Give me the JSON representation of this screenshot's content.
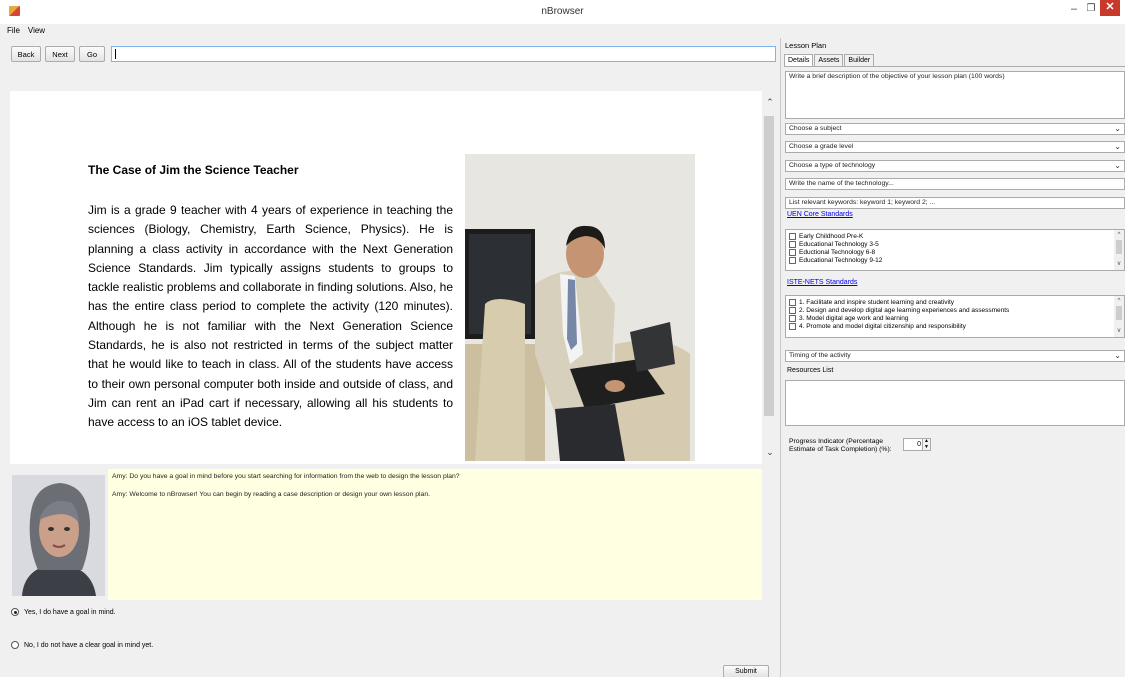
{
  "window": {
    "title": "nBrowser",
    "min_glyph": "–",
    "max_glyph": "❐",
    "close_glyph": "✕"
  },
  "menu": {
    "file": "File",
    "view": "View"
  },
  "toolbar": {
    "back": "Back",
    "next": "Next",
    "go": "Go",
    "address_value": ""
  },
  "article": {
    "title": "The Case of Jim the Science Teacher",
    "body": "Jim is a grade 9 teacher with 4 years of experience in teaching the sciences (Biology, Chemistry, Earth Science, Physics). He is planning a class activity in accordance with the Next Generation Science Standards. Jim typically assigns students to groups to tackle realistic problems and collaborate in finding solutions. Also, he has the entire class period to complete the activity (120 minutes). Although he is not familiar with the Next Generation Science Standards, he is also not restricted in terms of the subject matter that he would like to teach in class. All of the students have access to their own personal computer both inside and outside of class, and Jim can rent an iPad cart if necessary, allowing all his students to have access to an iOS tablet device."
  },
  "chat": {
    "messages": [
      "Amy: Do you have a goal in mind before you start searching for information from the web to design the lesson plan?",
      "Amy: Welcome to nBrowser! You can begin by reading a case description or design your own lesson plan."
    ]
  },
  "answers": {
    "option_yes": "Yes, I do have a goal in mind.",
    "option_no": "No, I do not have a clear goal in mind yet.",
    "submit": "Submit"
  },
  "lesson_plan": {
    "label": "Lesson Plan",
    "tabs": [
      "Details",
      "Assets",
      "Builder"
    ],
    "objective_placeholder": "Write a brief description of the objective of your lesson plan (100 words)",
    "subject": "Choose a subject",
    "grade": "Choose a grade level",
    "tech_type": "Choose a type of technology",
    "tech_name": "Write the name of the technology...",
    "keywords": "List relevant keywords: keyword 1; keyword 2; ...",
    "uen_link": "UEN Core Standards",
    "uen_items": [
      "Early Childhood Pre-K",
      "Educational Technology 3-5",
      "Eductional Technology 6-8",
      "Educational Technology 9-12"
    ],
    "iste_link": "ISTE-NETS Standards",
    "iste_items": [
      "1. Facilitate and inspire student learning and creativity",
      "2. Design and develop digital age learning experiences and assessments",
      "3. Model digital age work and learning",
      "4. Promote and model digital citizenship and responsibility"
    ],
    "timing": "Timing of the activity",
    "resources_label": "Resources List",
    "progress_label_1": "Progress Indicator (Percentage",
    "progress_label_2": "Estimate of Task Completion) (%):",
    "progress_value": "0"
  },
  "colors": {
    "chat_bg": "#ffffe1",
    "close_red": "#c7392a",
    "link_blue": "#0000ee"
  }
}
